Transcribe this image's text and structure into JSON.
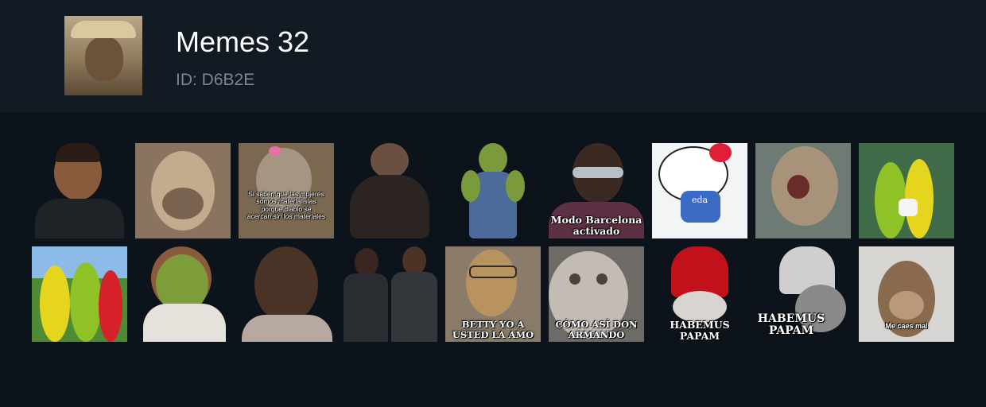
{
  "pack": {
    "title": "Memes 32",
    "id_text": "ID: D6B2E",
    "icon": "monkey-with-hat-icon"
  },
  "stickers": [
    {
      "subject": "basketball-player-smirk",
      "caption": ""
    },
    {
      "subject": "monkey-face-closeup",
      "caption": ""
    },
    {
      "subject": "monkey-with-pink-bow",
      "caption": "Si saben que las mujeres\nsomos materialistas\nporque diablo se\nacercan sin los materiales"
    },
    {
      "subject": "chubby-hippo-person",
      "caption": ""
    },
    {
      "subject": "green-ogre-woman",
      "caption": ""
    },
    {
      "subject": "kid-with-sunglasses",
      "caption": "Modo Barcelona\nactivado"
    },
    {
      "subject": "hello-kitty-sunglasses",
      "caption": "eda"
    },
    {
      "subject": "screaming-monkey",
      "caption": ""
    },
    {
      "subject": "teletubbies-hug",
      "caption": ""
    },
    {
      "subject": "teletubbies-hug-field",
      "caption": ""
    },
    {
      "subject": "fiona-ogre-smile",
      "caption": ""
    },
    {
      "subject": "old-man-portrait",
      "caption": ""
    },
    {
      "subject": "football-players",
      "caption": ""
    },
    {
      "subject": "dog-with-glasses",
      "caption": "BETTY YO A\nUSTED LA AMO"
    },
    {
      "subject": "alien-cat-closeup",
      "caption": "CÓMO ASÍ DON\nARMANDO"
    },
    {
      "subject": "cat-with-red-mitre",
      "caption": "HABEMUS\nPAPAM"
    },
    {
      "subject": "cat-with-white-mitre",
      "caption": "HABEMUS\nPAPAM"
    },
    {
      "subject": "monkey-me-caes-mal",
      "caption": "Me caes mal"
    }
  ]
}
